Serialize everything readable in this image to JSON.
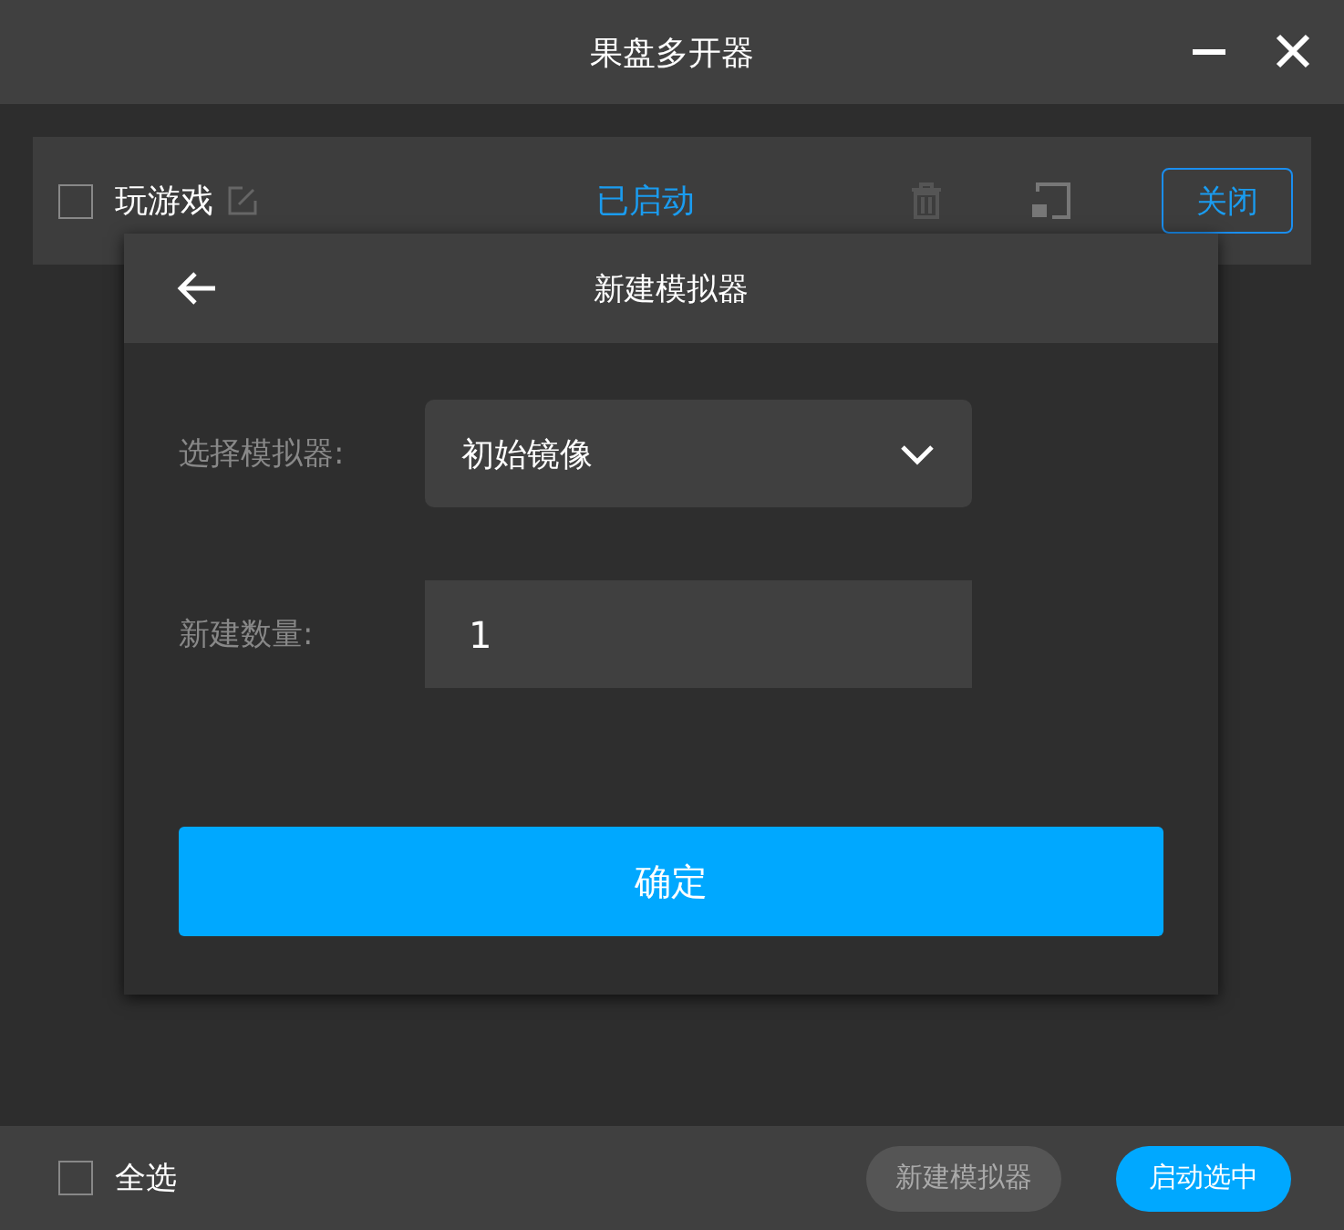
{
  "window": {
    "title": "果盘多开器"
  },
  "instances": [
    {
      "name": "玩游戏",
      "checked": false,
      "status": "已启动",
      "action": "关闭"
    }
  ],
  "dialog": {
    "title": "新建模拟器",
    "fields": [
      {
        "kind": "select",
        "label": "选择模拟器:",
        "value": "初始镜像"
      },
      {
        "kind": "input",
        "label": "新建数量:",
        "value": "1"
      }
    ],
    "confirm": "确定"
  },
  "footer": {
    "select_all": {
      "label": "全选",
      "checked": false
    },
    "buttons": [
      {
        "label": "新建模拟器",
        "primary": false
      },
      {
        "label": "启动选中",
        "primary": true
      }
    ]
  }
}
